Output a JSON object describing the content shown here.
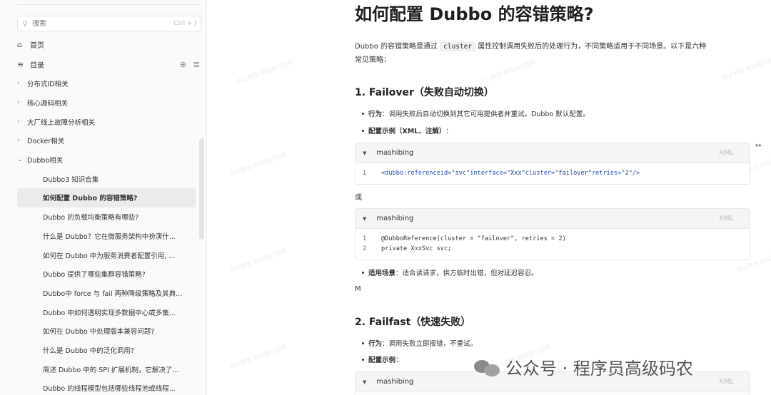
{
  "sidebar": {
    "search": {
      "placeholder": "搜索",
      "shortcut": "Ctrl + J"
    },
    "home": "首页",
    "toc": "目录",
    "items": [
      {
        "label": "分布式ID相关",
        "expanded": false
      },
      {
        "label": "核心源码相关",
        "expanded": false
      },
      {
        "label": "大厂线上故障分析相关",
        "expanded": false
      },
      {
        "label": "Docker相关",
        "expanded": false
      },
      {
        "label": "Dubbo相关",
        "expanded": true
      }
    ],
    "children": [
      "Dubbo3 知识合集",
      "如何配置 Dubbo 的容错策略?",
      "Dubbo 的负载均衡策略有哪些?",
      "什么是 Dubbo？它在微服务架构中扮演什...",
      "如何在 Dubbo 中为服务消费者配置引用, ...",
      "Dubbo 提供了哪些集群容错策略?",
      "Dubbo中 force 与 fail 两种降级策略及其典...",
      "Dubbo 中如何透明实现多数据中心或多集...",
      "如何在 Dubbo 中处理版本兼容问题?",
      "什么是 Dubbo 中的泛化调用?",
      "简述 Dubbo 中的 SPI 扩展机制，它解决了...",
      "Dubbo 的线程模型包括哪些线程池或线程..."
    ]
  },
  "article": {
    "title": "如何配置 Dubbo 的容错策略?",
    "intro_before": "Dubbo 的容错策略是通过",
    "intro_code": "cluster",
    "intro_after_line1": "属性控制调用失败后的处理行为，不同策略适用于不同场景。以下是六种",
    "intro_line2": "常见策略：",
    "s1_title": "1. Failover（失败自动切换）",
    "s1_b1_label": "行为",
    "s1_b1_text": "：调用失败后自动切换到其它可用提供者并重试。Dubbo 默认配置。",
    "s1_b2_label": "配置示例（XML、注解）",
    "s1_b2_text": "：",
    "code1_name": "mashibing",
    "code1_lang": "XML",
    "code1_ln": "1",
    "code1_tag_open": "<dubbo:reference",
    "code1_attr_id": "id=",
    "code1_val_id": "\"svc\"",
    "code1_attr_iface": "interface=",
    "code1_val_iface": "\"Xxx\"",
    "code1_attr_cluster": "cluster=",
    "code1_val_cluster": "\"failover\"",
    "code1_attr_retries": "retries=",
    "code1_val_retries": "\"2\"",
    "code1_tag_close": "/>",
    "or_text": "或",
    "code2_name": "mashibing",
    "code2_lang": "XML",
    "code2_lines": [
      {
        "ln": "1",
        "text": "@DubboReference(cluster = \"failover\", retries = 2)"
      },
      {
        "ln": "2",
        "text": "private XxxSvc svc;"
      }
    ],
    "s1_b3_label": "适用场景",
    "s1_b3_text": "：适合读请求，供方临时出错，但对延迟容忍。",
    "stray_m": "M",
    "s2_title": "2. Failfast（快速失败）",
    "s2_b1_label": "行为",
    "s2_b1_text": "：调用失败立即报错，不重试。",
    "s2_b2_label": "配置示例",
    "s2_b2_text": "：",
    "code3_name": "mashibing",
    "code3_lang": "XML"
  },
  "watermark": "码士教育-精益面试宝典",
  "brand": "公众号 · 程序员高级码农"
}
